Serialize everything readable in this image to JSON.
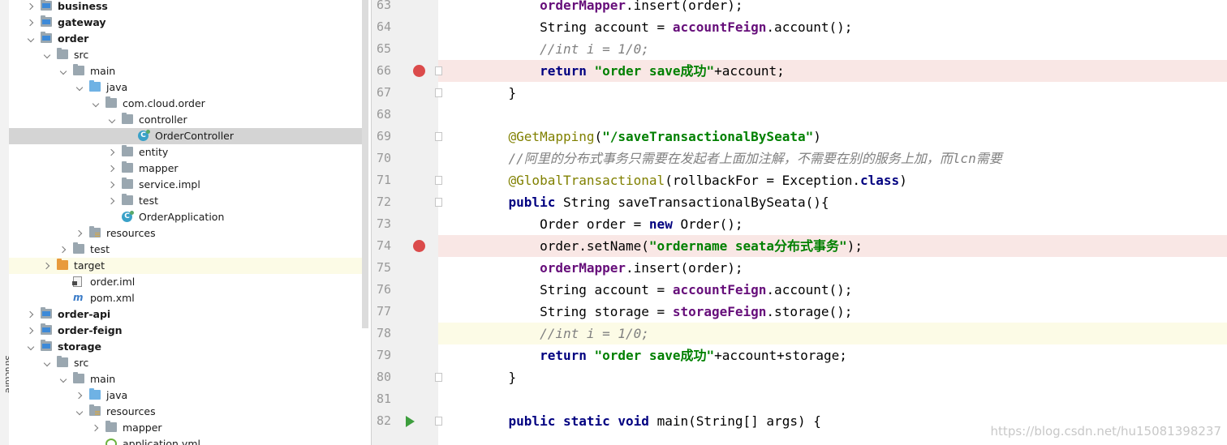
{
  "side_strip": {
    "label": "Structure"
  },
  "tree": [
    {
      "label": "business",
      "depth": 1,
      "arrow": "closed",
      "icon": "module",
      "bold": true
    },
    {
      "label": "gateway",
      "depth": 1,
      "arrow": "closed",
      "icon": "module",
      "bold": true
    },
    {
      "label": "order",
      "depth": 1,
      "arrow": "open",
      "icon": "module",
      "bold": true
    },
    {
      "label": "src",
      "depth": 2,
      "arrow": "open",
      "icon": "folder",
      "bold": false
    },
    {
      "label": "main",
      "depth": 3,
      "arrow": "open",
      "icon": "folder",
      "bold": false
    },
    {
      "label": "java",
      "depth": 4,
      "arrow": "open",
      "icon": "java",
      "bold": false
    },
    {
      "label": "com.cloud.order",
      "depth": 5,
      "arrow": "open",
      "icon": "folder",
      "bold": false
    },
    {
      "label": "controller",
      "depth": 6,
      "arrow": "open",
      "icon": "folder",
      "bold": false
    },
    {
      "label": "OrderController",
      "depth": 7,
      "arrow": "",
      "icon": "class",
      "bold": false,
      "selected": true
    },
    {
      "label": "entity",
      "depth": 6,
      "arrow": "closed",
      "icon": "folder",
      "bold": false
    },
    {
      "label": "mapper",
      "depth": 6,
      "arrow": "closed",
      "icon": "folder",
      "bold": false
    },
    {
      "label": "service.impl",
      "depth": 6,
      "arrow": "closed",
      "icon": "folder",
      "bold": false
    },
    {
      "label": "test",
      "depth": 6,
      "arrow": "closed",
      "icon": "folder",
      "bold": false
    },
    {
      "label": "OrderApplication",
      "depth": 6,
      "arrow": "",
      "icon": "class",
      "bold": false
    },
    {
      "label": "resources",
      "depth": 4,
      "arrow": "closed",
      "icon": "res",
      "bold": false
    },
    {
      "label": "test",
      "depth": 3,
      "arrow": "closed",
      "icon": "folder",
      "bold": false
    },
    {
      "label": "target",
      "depth": 2,
      "arrow": "closed",
      "icon": "orange",
      "bold": false,
      "highlight": true
    },
    {
      "label": "order.iml",
      "depth": 3,
      "arrow": "",
      "icon": "file",
      "bold": false
    },
    {
      "label": "pom.xml",
      "depth": 3,
      "arrow": "",
      "icon": "maven",
      "bold": false
    },
    {
      "label": "order-api",
      "depth": 1,
      "arrow": "closed",
      "icon": "module",
      "bold": true
    },
    {
      "label": "order-feign",
      "depth": 1,
      "arrow": "closed",
      "icon": "module",
      "bold": true
    },
    {
      "label": "storage",
      "depth": 1,
      "arrow": "open",
      "icon": "module",
      "bold": true
    },
    {
      "label": "src",
      "depth": 2,
      "arrow": "open",
      "icon": "folder",
      "bold": false
    },
    {
      "label": "main",
      "depth": 3,
      "arrow": "open",
      "icon": "folder",
      "bold": false
    },
    {
      "label": "java",
      "depth": 4,
      "arrow": "closed",
      "icon": "java",
      "bold": false
    },
    {
      "label": "resources",
      "depth": 4,
      "arrow": "open",
      "icon": "res",
      "bold": false
    },
    {
      "label": "mapper",
      "depth": 5,
      "arrow": "closed",
      "icon": "folder",
      "bold": false
    },
    {
      "label": "application.yml",
      "depth": 5,
      "arrow": "",
      "icon": "yml",
      "bold": false
    }
  ],
  "editor": {
    "lines": [
      {
        "num": "63",
        "marker": "",
        "fold": false,
        "tokens": [
          {
            "t": "        "
          },
          {
            "t": "orderMapper",
            "c": "fld"
          },
          {
            "t": ".insert(order);"
          }
        ]
      },
      {
        "num": "64",
        "marker": "",
        "fold": false,
        "tokens": [
          {
            "t": "        String account = "
          },
          {
            "t": "accountFeign",
            "c": "fld"
          },
          {
            "t": ".account();"
          }
        ]
      },
      {
        "num": "65",
        "marker": "",
        "fold": false,
        "tokens": [
          {
            "t": "        "
          },
          {
            "t": "//int i = 1/0;",
            "c": "cmt"
          }
        ]
      },
      {
        "num": "66",
        "marker": "breakpoint",
        "fold": true,
        "tokens": [
          {
            "t": "        "
          },
          {
            "t": "return ",
            "c": "kw"
          },
          {
            "t": "\"order save成功\"",
            "c": "str"
          },
          {
            "t": "+account;"
          }
        ]
      },
      {
        "num": "67",
        "marker": "",
        "fold": true,
        "tokens": [
          {
            "t": "    }"
          }
        ]
      },
      {
        "num": "68",
        "marker": "",
        "fold": false,
        "tokens": [
          {
            "t": ""
          }
        ]
      },
      {
        "num": "69",
        "marker": "",
        "fold": true,
        "tokens": [
          {
            "t": "    "
          },
          {
            "t": "@GetMapping",
            "c": "ann"
          },
          {
            "t": "("
          },
          {
            "t": "\"/saveTransactionalBySeata\"",
            "c": "str"
          },
          {
            "t": ")"
          }
        ]
      },
      {
        "num": "70",
        "marker": "",
        "fold": false,
        "tokens": [
          {
            "t": "    "
          },
          {
            "t": "//阿里的分布式事务只需要在发起者上面加注解，不需要在别的服务上加，而lcn需要",
            "c": "cmt"
          }
        ]
      },
      {
        "num": "71",
        "marker": "",
        "fold": true,
        "tokens": [
          {
            "t": "    "
          },
          {
            "t": "@GlobalTransactional",
            "c": "ann"
          },
          {
            "t": "(rollbackFor = Exception."
          },
          {
            "t": "class",
            "c": "kw"
          },
          {
            "t": ")"
          }
        ]
      },
      {
        "num": "72",
        "marker": "",
        "fold": true,
        "tokens": [
          {
            "t": "    "
          },
          {
            "t": "public ",
            "c": "kw"
          },
          {
            "t": "String saveTransactionalBySeata(){"
          }
        ]
      },
      {
        "num": "73",
        "marker": "",
        "fold": false,
        "tokens": [
          {
            "t": "        Order order = "
          },
          {
            "t": "new ",
            "c": "kw"
          },
          {
            "t": "Order();"
          }
        ]
      },
      {
        "num": "74",
        "marker": "breakpoint",
        "fold": false,
        "tokens": [
          {
            "t": "        order.setName("
          },
          {
            "t": "\"ordername seata分布式事务\"",
            "c": "str"
          },
          {
            "t": ");"
          }
        ]
      },
      {
        "num": "75",
        "marker": "",
        "fold": false,
        "tokens": [
          {
            "t": "        "
          },
          {
            "t": "orderMapper",
            "c": "fld"
          },
          {
            "t": ".insert(order);"
          }
        ]
      },
      {
        "num": "76",
        "marker": "",
        "fold": false,
        "tokens": [
          {
            "t": "        String account = "
          },
          {
            "t": "accountFeign",
            "c": "fld"
          },
          {
            "t": ".account();"
          }
        ]
      },
      {
        "num": "77",
        "marker": "",
        "fold": false,
        "tokens": [
          {
            "t": "        String storage = "
          },
          {
            "t": "storageFeign",
            "c": "fld"
          },
          {
            "t": ".storage();"
          }
        ]
      },
      {
        "num": "78",
        "marker": "current",
        "fold": false,
        "tokens": [
          {
            "t": "        "
          },
          {
            "t": "//int i = 1/0;",
            "c": "cmt"
          }
        ]
      },
      {
        "num": "79",
        "marker": "",
        "fold": false,
        "tokens": [
          {
            "t": "        "
          },
          {
            "t": "return ",
            "c": "kw"
          },
          {
            "t": "\"order save成功\"",
            "c": "str"
          },
          {
            "t": "+account+storage;"
          }
        ]
      },
      {
        "num": "80",
        "marker": "",
        "fold": true,
        "tokens": [
          {
            "t": "    }"
          }
        ]
      },
      {
        "num": "81",
        "marker": "",
        "fold": false,
        "tokens": [
          {
            "t": ""
          }
        ]
      },
      {
        "num": "82",
        "marker": "run",
        "fold": true,
        "tokens": [
          {
            "t": "    "
          },
          {
            "t": "public static void ",
            "c": "kw"
          },
          {
            "t": "main(String[] args) {"
          }
        ]
      }
    ]
  },
  "watermark": "https://blog.csdn.net/hu15081398237"
}
